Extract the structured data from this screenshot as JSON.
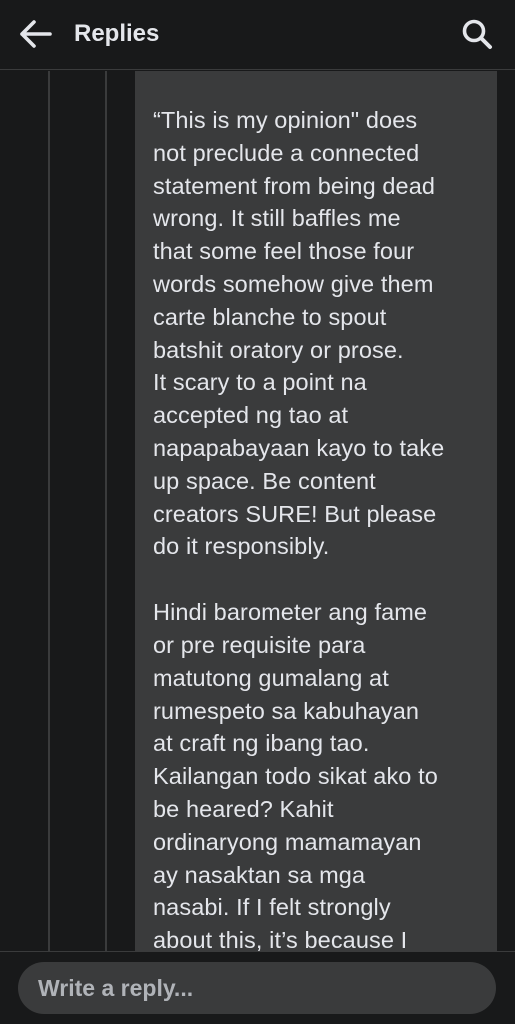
{
  "header": {
    "title": "Replies",
    "back_icon": "arrow-left-icon",
    "search_icon": "search-icon"
  },
  "comment": {
    "paragraphs": [
      "“This is my opinion\" does\nnot preclude a connected\nstatement from being dead\nwrong. It still baffles me\nthat some feel those four\nwords somehow give them\ncarte blanche to spout\nbatshit oratory or prose.\nIt scary to a point na\naccepted ng tao at\nnapapabayaan kayo to take\nup space. Be content\ncreators SURE! But please\ndo it responsibly.",
      "Hindi barometer ang fame\nor pre requisite para\nmatutong gumalang at\nrumespeto sa kabuhayan\nat craft ng ibang tao.\nKailangan todo sikat ako to\nbe heared? Kahit\nordinaryong mamamayan\nay nasaktan sa mga\nnasabi. If I felt strongly\nabout this, it’s because I"
    ]
  },
  "reply": {
    "placeholder": "Write a reply..."
  },
  "colors": {
    "background": "#18191a",
    "bubble": "#3a3b3c",
    "text": "#e4e6eb",
    "muted": "#b0b3b8"
  }
}
